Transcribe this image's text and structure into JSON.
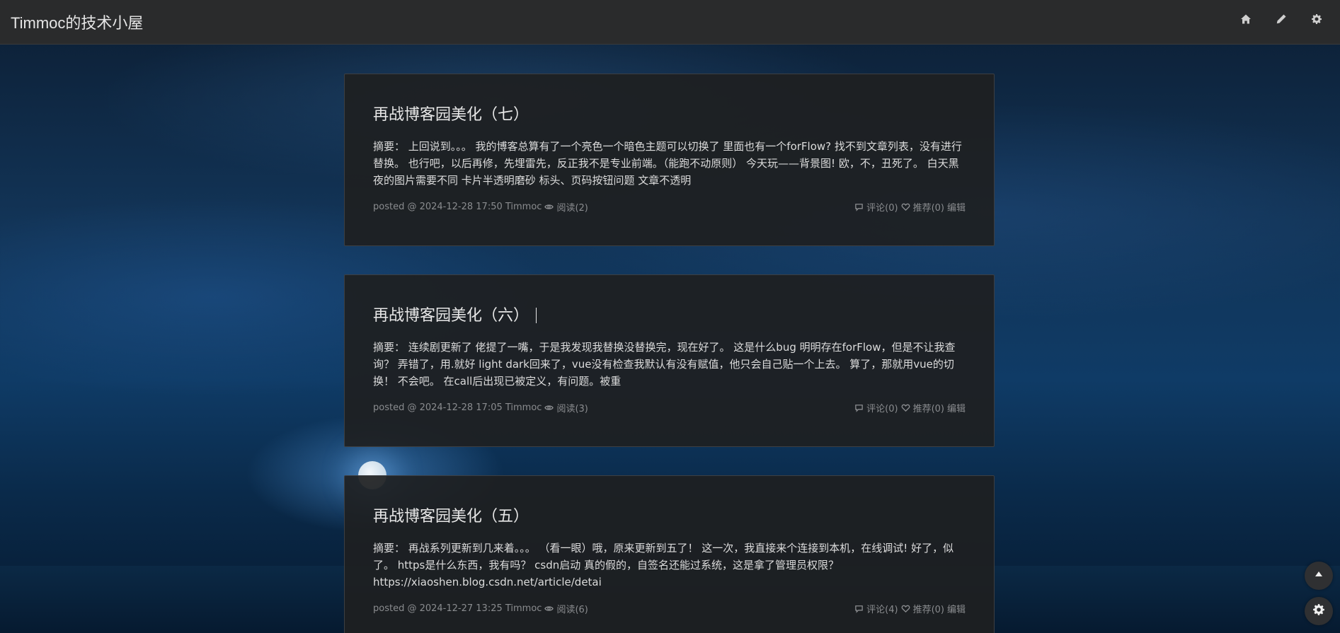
{
  "site": {
    "title": "Timmoc的技术小屋"
  },
  "topbar": {
    "icons": [
      "home-icon",
      "pencil-icon",
      "gear-icon"
    ]
  },
  "posts": [
    {
      "title": "再战博客园美化（七）",
      "summary": "摘要： 上回说到。。。 我的博客总算有了一个亮色一个暗色主题可以切换了 里面也有一个forFlow? 找不到文章列表，没有进行替换。 也行吧，以后再修，先埋雷先，反正我不是专业前端。（能跑不动原则） 今天玩——背景图! 欧，不，丑死了。 白天黑夜的图片需要不同 卡片半透明磨砂 标头、页码按钮问题 文章不透明",
      "posted": "posted @ 2024-12-28 17:50 Timmoc",
      "reads": "阅读(2)",
      "comments": "评论(0)",
      "recommend": "推荐(0)",
      "edit": "编辑"
    },
    {
      "title": "再战博客园美化（六）",
      "summary": "摘要： 连续剧更新了 佬提了一嘴，于是我发现我替换没替换完，现在好了。 这是什么bug 明明存在forFlow，但是不让我查询？ 弄错了，用.就好 light dark回来了，vue没有检查我默认有没有赋值，他只会自己贴一个上去。 算了，那就用vue的切换！ 不会吧。 在call后出现已被定义，有问题。被重",
      "posted": "posted @ 2024-12-28 17:05 Timmoc",
      "reads": "阅读(3)",
      "comments": "评论(0)",
      "recommend": "推荐(0)",
      "edit": "编辑"
    },
    {
      "title": "再战博客园美化（五）",
      "summary": "摘要： 再战系列更新到几来着。。。 （看一眼）哦，原来更新到五了！ 这一次，我直接来个连接到本机，在线调试! 好了，似了。 https是什么东西，我有吗？ csdn启动 真的假的，自签名还能过系统，这是拿了管理员权限？ https://xiaoshen.blog.csdn.net/article/detai",
      "posted": "posted @ 2024-12-27 13:25 Timmoc",
      "reads": "阅读(6)",
      "comments": "评论(4)",
      "recommend": "推荐(0)",
      "edit": "编辑"
    }
  ],
  "floating": [
    "arrow-up-icon",
    "settings-icon"
  ]
}
